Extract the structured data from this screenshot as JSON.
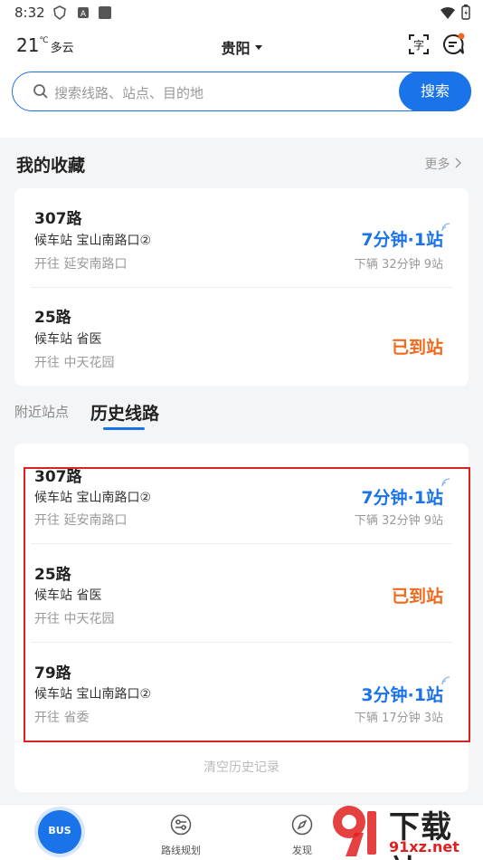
{
  "status_bar": {
    "time": "8:32"
  },
  "header": {
    "temperature": "21",
    "unit": "℃",
    "condition": "多云",
    "city": "贵阳"
  },
  "search": {
    "placeholder": "搜索线路、站点、目的地",
    "button": "搜索"
  },
  "favorites": {
    "title": "我的收藏",
    "more": "更多",
    "items": [
      {
        "route": "307路",
        "stop": "候车站 宝山南路口②",
        "direction": "开往 延安南路口",
        "eta": "7分钟·1站",
        "eta_sub": "下辆  32分钟 9站",
        "status": "realtime"
      },
      {
        "route": "25路",
        "stop": "候车站 省医",
        "direction": "开往 中天花园",
        "eta": "已到站",
        "eta_sub": "",
        "status": "arrived"
      }
    ]
  },
  "tabs": [
    {
      "label": "附近站点",
      "active": false
    },
    {
      "label": "历史线路",
      "active": true
    }
  ],
  "history": {
    "items": [
      {
        "route": "307路",
        "stop": "候车站 宝山南路口②",
        "direction": "开往 延安南路口",
        "eta": "7分钟·1站",
        "eta_sub": "下辆  32分钟 9站",
        "status": "realtime"
      },
      {
        "route": "25路",
        "stop": "候车站 省医",
        "direction": "开往 中天花园",
        "eta": "已到站",
        "eta_sub": "",
        "status": "arrived"
      },
      {
        "route": "79路",
        "stop": "候车站 宝山南路口②",
        "direction": "开往 省委",
        "eta": "3分钟·1站",
        "eta_sub": "下辆  17分钟 3站",
        "status": "realtime"
      }
    ],
    "clear_label": "清空历史记录"
  },
  "bottom_nav": [
    {
      "label": "BUS",
      "icon": "bus-icon"
    },
    {
      "label": "路线规划",
      "icon": "route-plan-icon"
    },
    {
      "label": "发现",
      "icon": "compass-icon"
    }
  ],
  "watermark": {
    "text": "下载站",
    "url": "91xz.net"
  },
  "colors": {
    "accent": "#1a73e8",
    "arrived": "#f06a1d",
    "highlight": "#e02020"
  }
}
